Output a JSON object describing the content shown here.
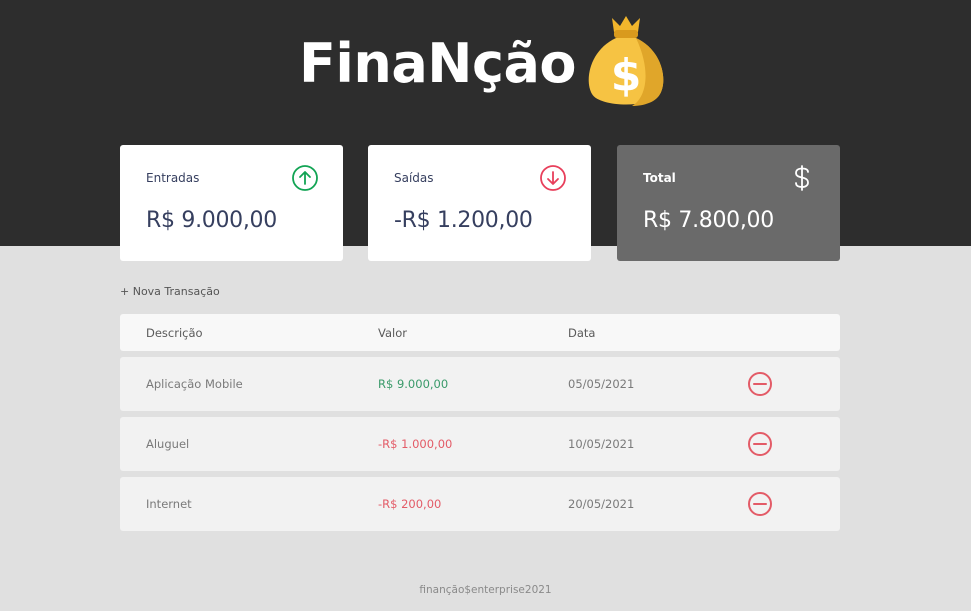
{
  "header": {
    "logo_text": "FinaNção"
  },
  "summary": {
    "income": {
      "title": "Entradas",
      "amount": "R$ 9.000,00",
      "icon": "arrow-up-circle-icon"
    },
    "expense": {
      "title": "Saídas",
      "amount": "-R$ 1.200,00",
      "icon": "arrow-down-circle-icon"
    },
    "total": {
      "title": "Total",
      "amount": "R$ 7.800,00",
      "icon": "dollar-icon"
    }
  },
  "actions": {
    "new_transaction": "+ Nova Transação"
  },
  "table": {
    "headers": [
      "Descrição",
      "Valor",
      "Data"
    ],
    "rows": [
      {
        "description": "Aplicação Mobile",
        "value": "R$ 9.000,00",
        "date": "05/05/2021",
        "type": "income"
      },
      {
        "description": "Aluguel",
        "value": "-R$ 1.000,00",
        "date": "10/05/2021",
        "type": "expense"
      },
      {
        "description": "Internet",
        "value": "-R$ 200,00",
        "date": "20/05/2021",
        "type": "expense"
      }
    ]
  },
  "footer": {
    "text": "finanção$enterprise2021"
  },
  "colors": {
    "header_bg": "#2d2d2d",
    "income_green": "#12a454",
    "expense_red": "#e83f5b",
    "total_card": "#6a6a6a"
  }
}
